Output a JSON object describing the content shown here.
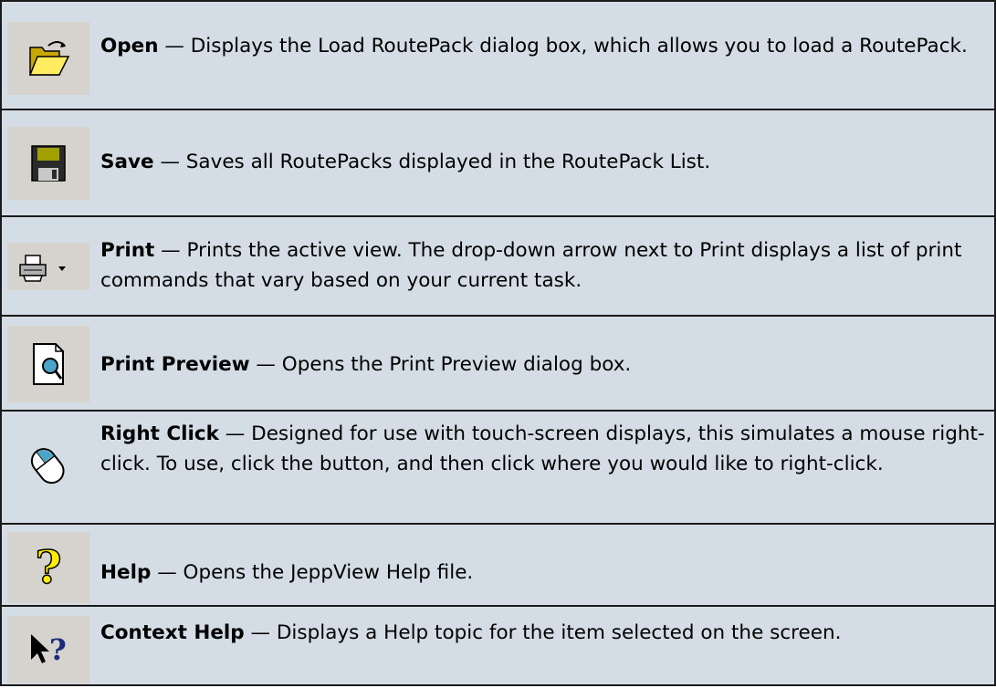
{
  "separator": "—",
  "rows": [
    {
      "icon": "open-folder-icon",
      "title": "Open",
      "desc": "Displays the Load RoutePack dialog box, which allows you to load a RoutePack."
    },
    {
      "icon": "save-floppy-icon",
      "title": "Save",
      "desc": "Saves all RoutePacks displayed in the RoutePack List."
    },
    {
      "icon": "printer-dropdown-icon",
      "title": "Print",
      "desc": "Prints the active view. The drop-down arrow next to Print displays a list of print commands that vary based on your current task."
    },
    {
      "icon": "print-preview-icon",
      "title": "Print Preview",
      "desc": "Opens the Print Preview dialog box."
    },
    {
      "icon": "mouse-icon",
      "title": "Right Click",
      "desc": "Designed for use with touch-screen displays, this simulates a mouse right-click. To use, click the button, and then click where you would like to right-click."
    },
    {
      "icon": "help-question-icon",
      "title": "Help",
      "desc": "Opens the JeppView Help file."
    },
    {
      "icon": "context-help-icon",
      "title": "Context Help",
      "desc": "Displays a Help topic for the item selected on the screen."
    }
  ]
}
